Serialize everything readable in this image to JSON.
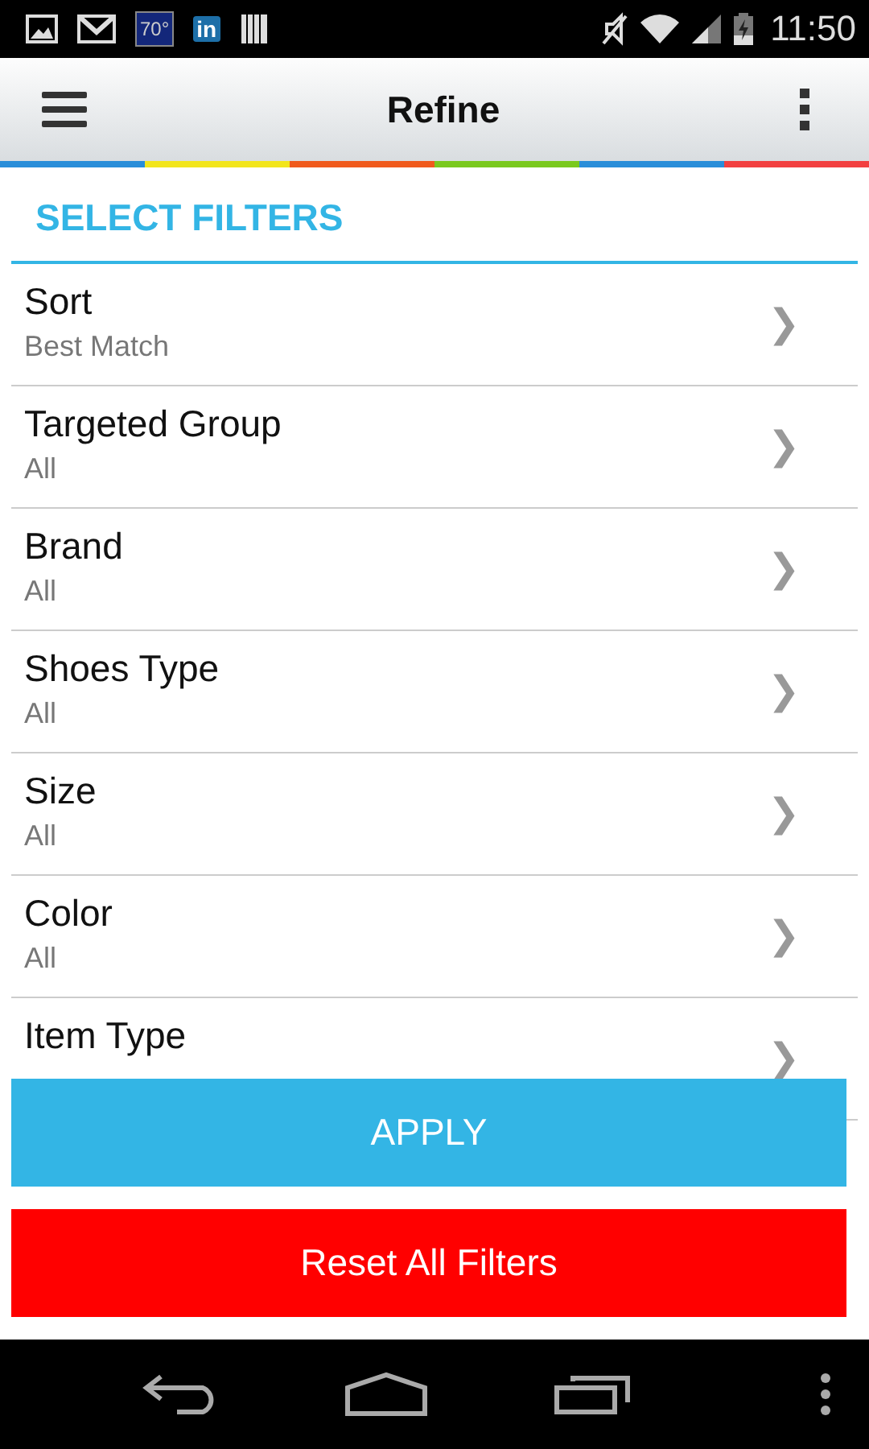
{
  "status_bar": {
    "weather": "70°",
    "linkedin": "in",
    "time": "11:50"
  },
  "header": {
    "title": "Refine"
  },
  "section": {
    "title": "SELECT FILTERS"
  },
  "filters": [
    {
      "label": "Sort",
      "value": "Best Match",
      "chevron": "❯"
    },
    {
      "label": "Targeted Group",
      "value": "All",
      "chevron": "❯"
    },
    {
      "label": "Brand",
      "value": "All",
      "chevron": "❯"
    },
    {
      "label": "Shoes Type",
      "value": "All",
      "chevron": "❯"
    },
    {
      "label": "Size",
      "value": "All",
      "chevron": "❯"
    },
    {
      "label": "Color",
      "value": "All",
      "chevron": "❯"
    },
    {
      "label": "Item Type",
      "chevron": "❯"
    }
  ],
  "buttons": [
    {
      "kind": "primary",
      "label": "APPLY"
    },
    {
      "kind": "danger",
      "label": "Reset All Filters"
    }
  ]
}
